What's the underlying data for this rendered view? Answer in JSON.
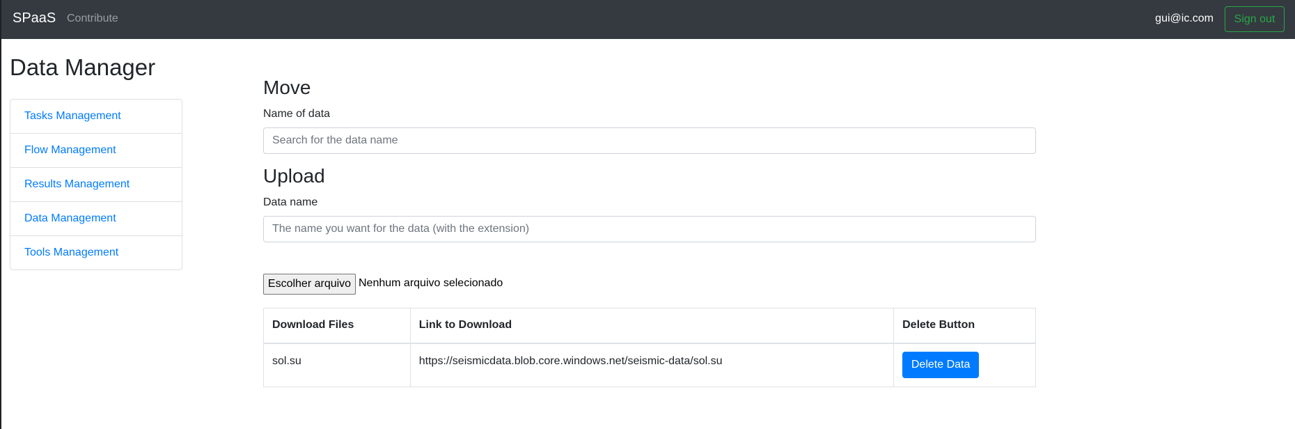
{
  "navbar": {
    "brand": "SPaaS",
    "contribute_link": "Contribute",
    "user_email": "gui@ic.com",
    "signout_label": "Sign out"
  },
  "sidebar": {
    "title": "Data Manager",
    "items": [
      {
        "label": "Tasks Management"
      },
      {
        "label": "Flow Management"
      },
      {
        "label": "Results Management"
      },
      {
        "label": "Data Management"
      },
      {
        "label": "Tools Management"
      }
    ]
  },
  "move": {
    "title": "Move",
    "label": "Name of data",
    "placeholder": "Search for the data name",
    "value": ""
  },
  "upload": {
    "title": "Upload",
    "label": "Data name",
    "placeholder": "The name you want for the data (with the extension)",
    "value": "",
    "file_button": "Escolher arquivo",
    "file_status": "Nenhum arquivo selecionado"
  },
  "table": {
    "headers": [
      "Download Files",
      "Link to Download",
      "Delete Button"
    ],
    "rows": [
      {
        "file": "sol.su",
        "link": "https://seismicdata.blob.core.windows.net/seismic-data/sol.su",
        "action": "Delete Data"
      }
    ]
  },
  "colors": {
    "navbar_bg": "#343a40",
    "link": "#007bff",
    "signout": "#28a745",
    "delete_button": "#007bff"
  }
}
